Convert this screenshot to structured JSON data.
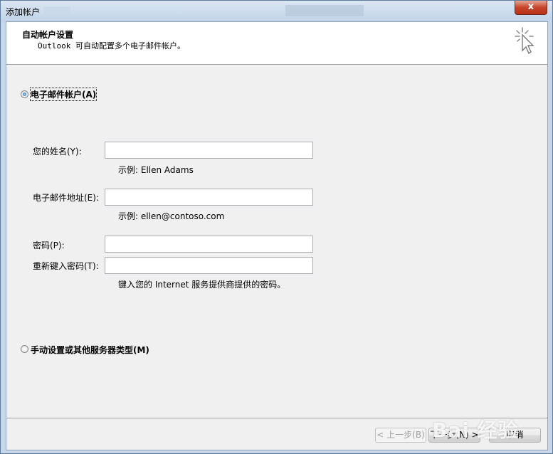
{
  "window": {
    "title": "添加帐户",
    "close_label": "x"
  },
  "header": {
    "title": "自动帐户设置",
    "subtitle": "Outlook 可自动配置多个电子邮件帐户。"
  },
  "email_option": {
    "label": "电子邮件帐户(A)",
    "selected": true
  },
  "form": {
    "name_label": "您的姓名(Y):",
    "name_value": "",
    "name_hint": "示例: Ellen Adams",
    "email_label": "电子邮件地址(E):",
    "email_value": "",
    "email_hint": "示例: ellen@contoso.com",
    "password_label": "密码(P):",
    "password_value": "",
    "retype_label": "重新键入密码(T):",
    "retype_value": "",
    "password_hint": "键入您的 Internet 服务提供商提供的密码。"
  },
  "manual_option": {
    "label": "手动设置或其他服务器类型(M)",
    "selected": false
  },
  "buttons": {
    "back": "< 上一步(B)",
    "next": "下一步(N) >",
    "cancel": "取消"
  },
  "watermark": {
    "text": "Bai 经验"
  }
}
